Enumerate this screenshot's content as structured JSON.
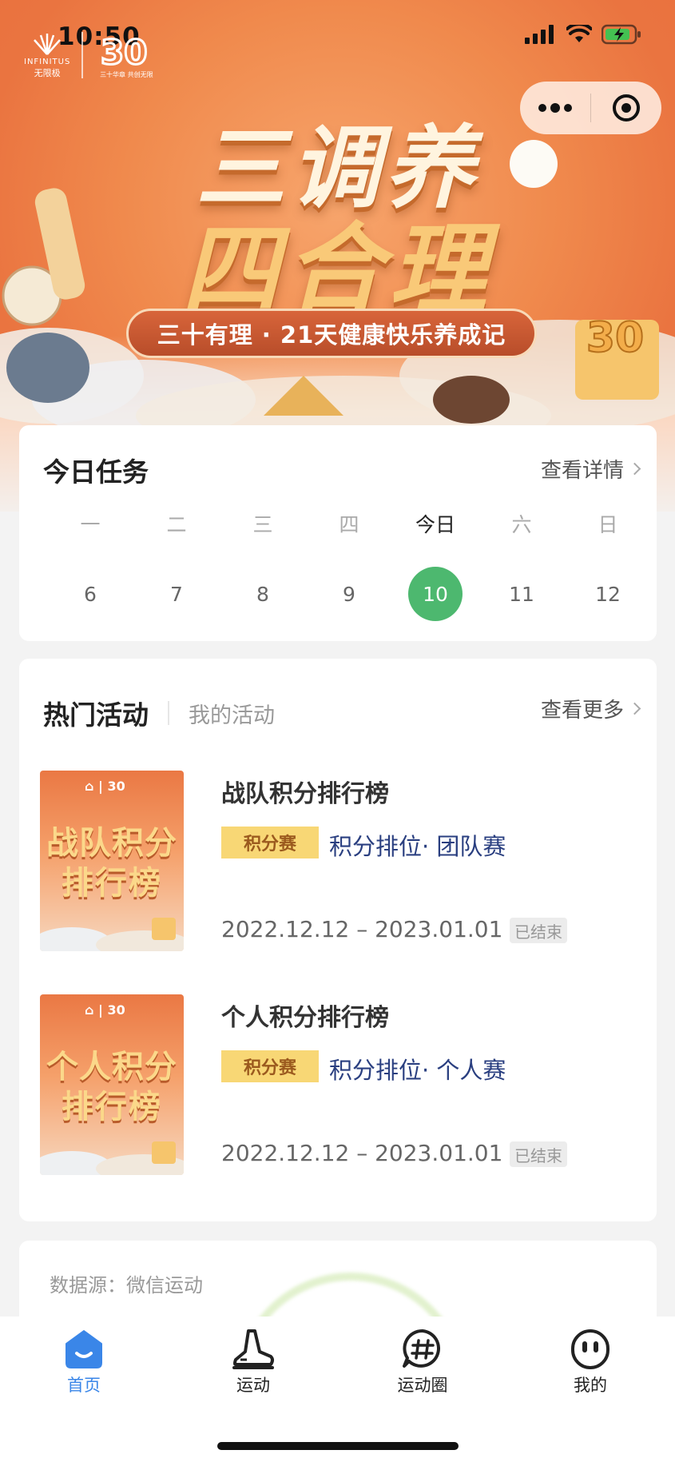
{
  "status_bar": {
    "time": "10:50"
  },
  "brand": {
    "name_en": "INFINITUS",
    "name_cn": "无限极",
    "anniversary": "30",
    "tagline": "三十华章 共创无限"
  },
  "banner": {
    "headline_1": "三调养",
    "headline_2": "四合理",
    "subtitle": "三十有理 · 21天健康快乐养成记",
    "badge": "30"
  },
  "today_task": {
    "title": "今日任务",
    "link": "查看详情",
    "weekdays": [
      "一",
      "二",
      "三",
      "四",
      "今日",
      "六",
      "日"
    ],
    "days": [
      "6",
      "7",
      "8",
      "9",
      "10",
      "11",
      "12"
    ],
    "selected_index": 4
  },
  "activities": {
    "tab_active": "热门活动",
    "tab_inactive": "我的活动",
    "link": "查看更多",
    "items": [
      {
        "thumb_line1": "战队积分",
        "thumb_line2": "排行榜",
        "title": "战队积分排行榜",
        "tag": "积分赛",
        "desc": "积分排位· 团队赛",
        "date": "2022.12.12 – 2023.01.01",
        "status": "已结束"
      },
      {
        "thumb_line1": "个人积分",
        "thumb_line2": "排行榜",
        "title": "个人积分排行榜",
        "tag": "积分赛",
        "desc": "积分排位· 个人赛",
        "date": "2022.12.12 – 2023.01.01",
        "status": "已结束"
      }
    ]
  },
  "data_card": {
    "source": "数据源：微信运动"
  },
  "tabbar": {
    "items": [
      {
        "label": "首页",
        "icon": "home-icon",
        "active": true
      },
      {
        "label": "运动",
        "icon": "sneaker-icon",
        "active": false
      },
      {
        "label": "运动圈",
        "icon": "hashtag-chat-icon",
        "active": false
      },
      {
        "label": "我的",
        "icon": "profile-face-icon",
        "active": false
      }
    ]
  },
  "colors": {
    "accent": "#4db86f",
    "tab_active": "#3a86e8",
    "tag_bg": "#f8d775",
    "desc_text": "#2a3f80",
    "banner": "#ee7d45"
  }
}
